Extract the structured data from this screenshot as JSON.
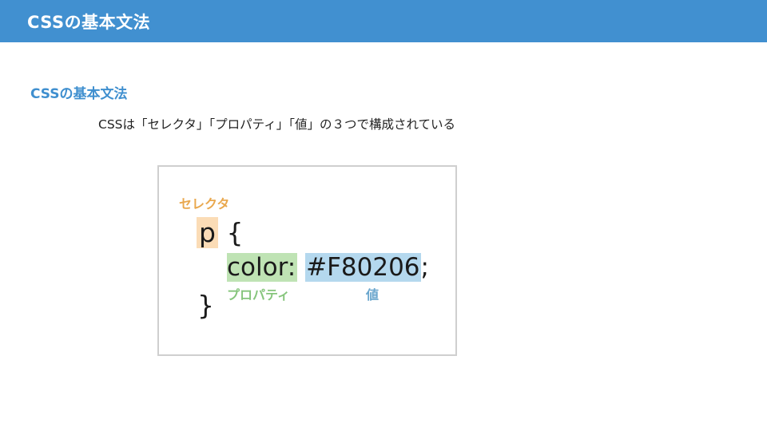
{
  "header": {
    "title": "CSSの基本文法",
    "background_color": "#4190d0"
  },
  "section": {
    "heading": "CSSの基本文法",
    "heading_color": "#3f8fcf",
    "description": "CSSは「セレクタ」「プロパティ」「値」の３つで構成されている"
  },
  "figure": {
    "label_selector": "セレクタ",
    "label_property": "プロパティ",
    "label_value": "値",
    "selector": "p",
    "open_brace": "{",
    "property": "color",
    "colon": ":",
    "value": "#F80206",
    "semicolon": ";",
    "close_brace": "}",
    "colors": {
      "selector_highlight": "#fbdcb6",
      "property_highlight": "#bfe3b4",
      "value_highlight": "#b4d8ee",
      "selector_label": "#e9a84e",
      "property_label": "#86c57c",
      "value_label": "#6aa6cd"
    }
  }
}
